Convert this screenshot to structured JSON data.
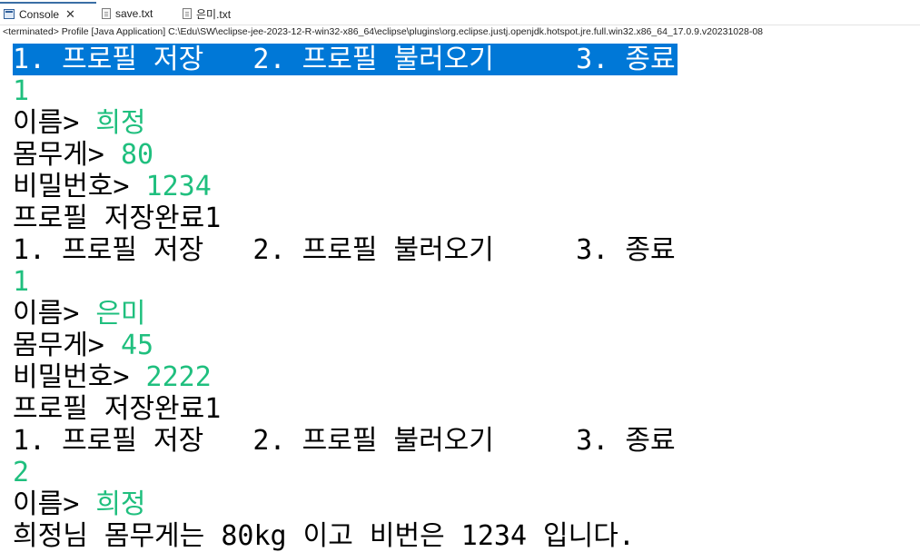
{
  "tabs": [
    {
      "label": "Console",
      "icon": "console-icon",
      "active": true
    },
    {
      "label": "save.txt",
      "icon": "file-icon",
      "active": false
    },
    {
      "label": "은미.txt",
      "icon": "file-icon",
      "active": false
    }
  ],
  "status": "<terminated> Profile [Java Application] C:\\Edu\\SW\\eclipse-jee-2023-12-R-win32-x86_64\\eclipse\\plugins\\org.eclipse.justj.openjdk.hotspot.jre.full.win32.x86_64_17.0.9.v20231028-08",
  "console": {
    "l01": "1. 프로필 저장   2. 프로필 불러오기     3. 종료",
    "l02": "1",
    "l03_prompt": "이름> ",
    "l03_value": "희정",
    "l04_prompt": "몸무게> ",
    "l04_value": "80",
    "l05_prompt": "비밀번호> ",
    "l05_value": "1234",
    "l06": "프로필 저장완료1",
    "l07": "1. 프로필 저장   2. 프로필 불러오기     3. 종료",
    "l08": "1",
    "l09_prompt": "이름> ",
    "l09_value": "은미",
    "l10_prompt": "몸무게> ",
    "l10_value": "45",
    "l11_prompt": "비밀번호> ",
    "l11_value": "2222",
    "l12": "프로필 저장완료1",
    "l13": "1. 프로필 저장   2. 프로필 불러오기     3. 종료",
    "l14": "2",
    "l15_prompt": "이름> ",
    "l15_value": "희정",
    "l16": "희정님 몸무게는 80kg 이고 비번은 1234 입니다."
  },
  "colors": {
    "output_text": "#000000",
    "user_input": "#1fbf7e",
    "selection": "#0078d7"
  }
}
